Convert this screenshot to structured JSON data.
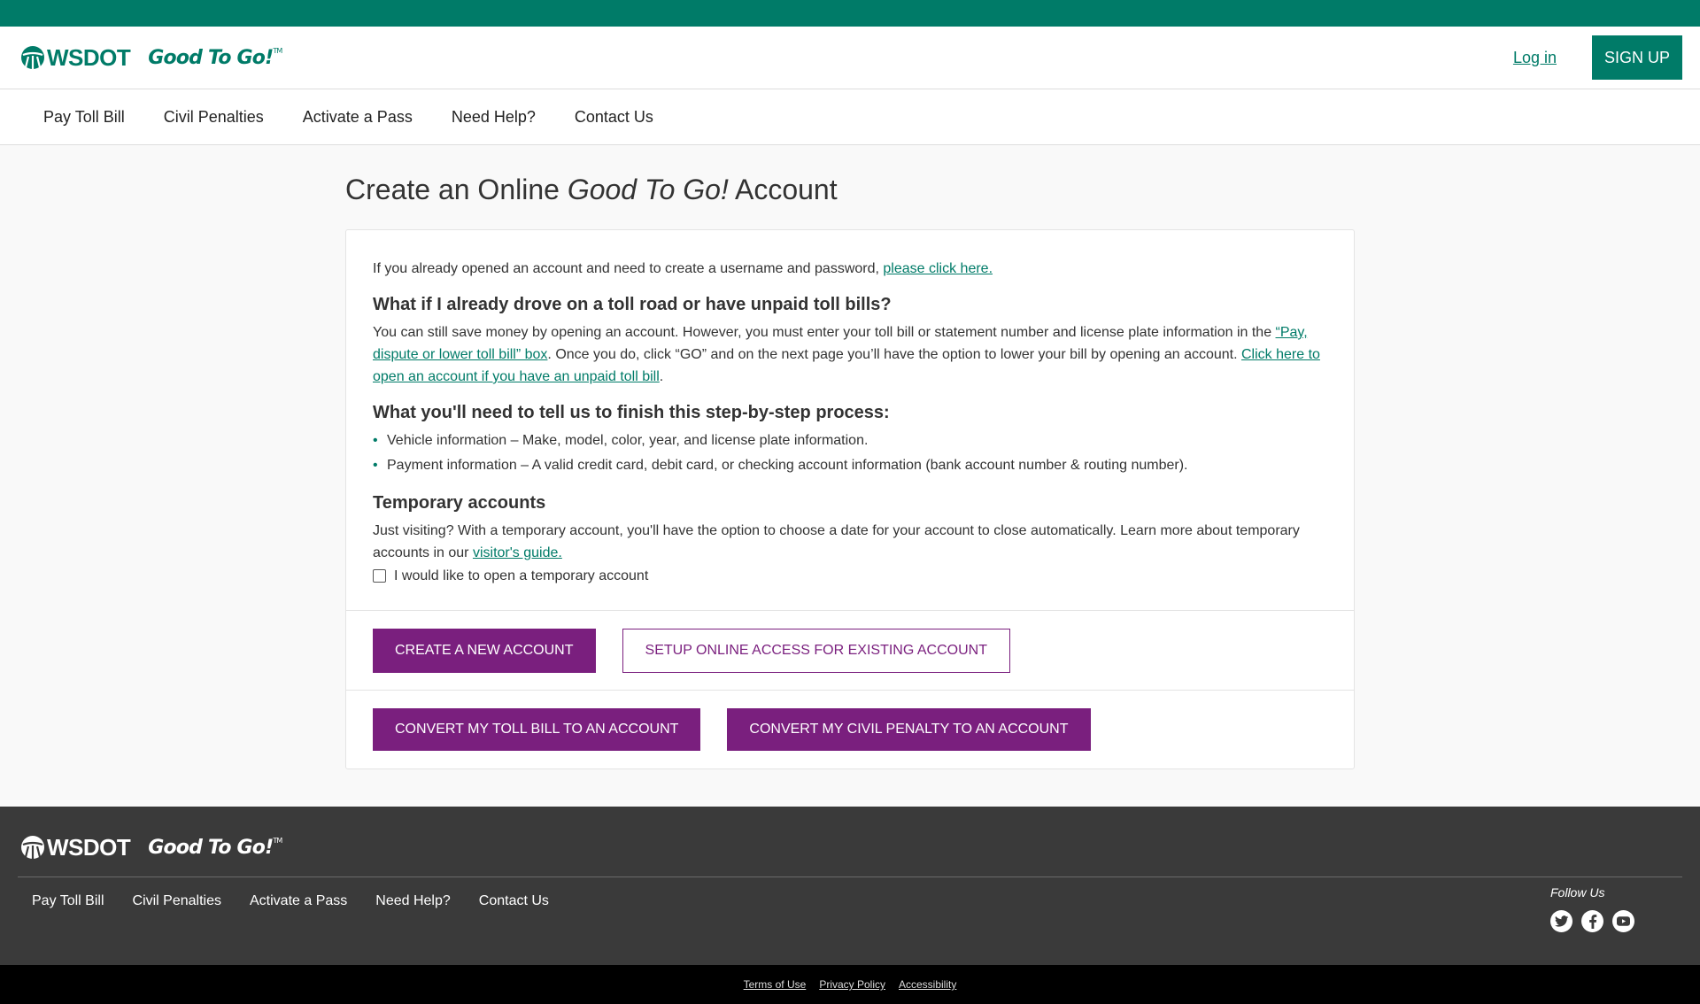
{
  "colors": {
    "brand_green": "#007b68",
    "accent_purple": "#7a1f7e",
    "footer_bg": "#3a3a3a",
    "bottom_bar_bg": "#000000"
  },
  "header": {
    "wsdot_logo": "WSDOT",
    "gtg_logo": "Good To Go!",
    "trademark": "TM",
    "login_label": "Log in",
    "signup_label": "SIGN UP"
  },
  "nav": {
    "items": [
      "Pay Toll Bill",
      "Civil Penalties",
      "Activate a Pass",
      "Need Help?",
      "Contact Us"
    ]
  },
  "page": {
    "title_prefix": "Create an Online ",
    "title_brand": "Good To Go!",
    "title_suffix": " Account"
  },
  "card": {
    "intro_text": "If you already opened an account and need to create a username and password, ",
    "intro_link": "please click here.",
    "section1_heading": "What if I already drove on a toll road or have unpaid toll bills?",
    "section1_text_a": "You can still save money by opening an account. However, you must enter your toll bill or statement number and license plate information in the ",
    "section1_link_a": "“Pay, dispute or lower toll bill” box",
    "section1_text_b": ". Once you do, click “GO” and on the next page you’ll have the option to lower your bill by opening an account. ",
    "section1_link_b": "Click here to open an account if you have an unpaid toll bill",
    "section1_text_c": ".",
    "section2_heading": "What you'll need to tell us to finish this step-by-step process:",
    "section2_items": [
      "Vehicle information – Make, model, color, year, and license plate information.",
      "Payment information – A valid credit card, debit card, or checking account information (bank account number & routing number)."
    ],
    "section3_heading": "Temporary accounts",
    "section3_text": "Just visiting? With a temporary account, you'll have the option to choose a date for your account to close automatically. Learn more about temporary accounts in our ",
    "section3_link": "visitor's guide.",
    "temp_checkbox_label": "I would like to open a temporary account",
    "temp_checkbox_checked": false
  },
  "buttons": {
    "create_new": "CREATE A NEW ACCOUNT",
    "setup_online": "SETUP ONLINE ACCESS FOR EXISTING ACCOUNT",
    "convert_toll_bill": "CONVERT MY TOLL BILL TO AN ACCOUNT",
    "convert_civil_penalty": "CONVERT MY CIVIL PENALTY TO AN ACCOUNT"
  },
  "footer": {
    "wsdot_logo": "WSDOT",
    "gtg_logo": "Good To Go!",
    "trademark": "TM",
    "nav_items": [
      "Pay Toll Bill",
      "Civil Penalties",
      "Activate a Pass",
      "Need Help?",
      "Contact Us"
    ],
    "follow_label": "Follow Us",
    "social": [
      "twitter-icon",
      "facebook-icon",
      "youtube-icon"
    ]
  },
  "bottom_links": [
    "Terms of Use",
    "Privacy Policy",
    "Accessibility"
  ]
}
